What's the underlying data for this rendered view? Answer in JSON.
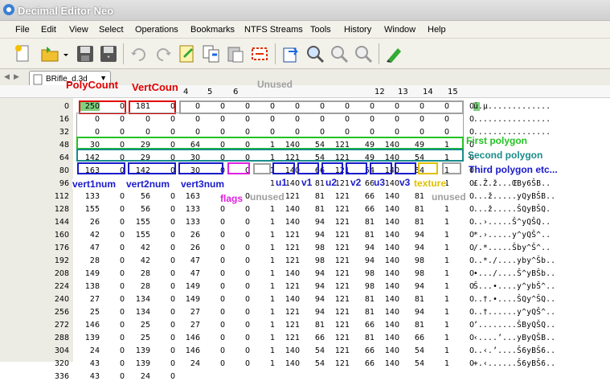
{
  "window": {
    "title": "Decimal Editor Neo"
  },
  "menu": [
    "File",
    "Edit",
    "View",
    "Select",
    "Operations",
    "Bookmarks",
    "NTFS Streams",
    "Tools",
    "History",
    "Window",
    "Help"
  ],
  "toolbar": {
    "icons": [
      "new-document-icon",
      "open-folder-icon",
      "dropdown-arrow-icon",
      "save-icon",
      "save-as-icon",
      "undo-icon",
      "redo-icon",
      "edit-notes-icon",
      "copy-icon",
      "paste-icon",
      "select-block-icon",
      "export-icon",
      "find-icon",
      "find-next-icon",
      "find-previous-icon",
      "go-to-icon"
    ]
  },
  "tab": {
    "label": "BRifle_d.3d"
  },
  "column_headers": [
    "4",
    "5",
    "6",
    "12",
    "13",
    "14",
    "15"
  ],
  "rows": [
    {
      "offset": "0",
      "values": [
        "250",
        "0",
        "181",
        "0",
        "0",
        "0",
        "0",
        "0",
        "0",
        "0",
        "0",
        "0",
        "0",
        "0",
        "0",
        "0"
      ],
      "ascii": "ú.µ............."
    },
    {
      "offset": "16",
      "values": [
        "0",
        "0",
        "0",
        "0",
        "0",
        "0",
        "0",
        "0",
        "0",
        "0",
        "0",
        "0",
        "0",
        "0",
        "0",
        "0"
      ],
      "ascii": "................"
    },
    {
      "offset": "32",
      "values": [
        "0",
        "0",
        "0",
        "0",
        "0",
        "0",
        "0",
        "0",
        "0",
        "0",
        "0",
        "0",
        "0",
        "0",
        "0",
        "0"
      ],
      "ascii": "................"
    },
    {
      "offset": "48",
      "values": [
        "30",
        "0",
        "29",
        "0",
        "64",
        "0",
        "0",
        "1",
        "140",
        "54",
        "121",
        "49",
        "140",
        "49",
        "1",
        "0"
      ],
      "ascii": ""
    },
    {
      "offset": "64",
      "values": [
        "142",
        "0",
        "29",
        "0",
        "30",
        "0",
        "0",
        "1",
        "121",
        "54",
        "121",
        "49",
        "140",
        "54",
        "1",
        "0"
      ],
      "ascii": ""
    },
    {
      "offset": "80",
      "values": [
        "163",
        "0",
        "142",
        "0",
        "30",
        "0",
        "0",
        "1",
        "140",
        "66",
        "121",
        "54",
        "140",
        "54",
        "1",
        "0"
      ],
      "ascii": ""
    },
    {
      "offset": "96",
      "values": [
        "",
        "",
        "",
        "",
        "",
        "",
        "",
        "1",
        "140",
        "81",
        "121",
        "66",
        "140",
        "66",
        "1",
        "0"
      ],
      "ascii": "£.Ž.ž...ŒBy6ŠB.."
    },
    {
      "offset": "112",
      "values": [
        "133",
        "0",
        "56",
        "0",
        "163",
        "0",
        "0",
        "1",
        "121",
        "81",
        "121",
        "66",
        "140",
        "81",
        "1",
        "0"
      ],
      "ascii": "...ž.....yQyBŠB.."
    },
    {
      "offset": "128",
      "values": [
        "155",
        "0",
        "56",
        "0",
        "133",
        "0",
        "0",
        "1",
        "140",
        "81",
        "121",
        "66",
        "140",
        "81",
        "1",
        "0"
      ],
      "ascii": "...ž.....ŠQyBŠQ."
    },
    {
      "offset": "144",
      "values": [
        "26",
        "0",
        "155",
        "0",
        "133",
        "0",
        "0",
        "1",
        "140",
        "94",
        "121",
        "81",
        "140",
        "81",
        "1",
        "0"
      ],
      "ascii": "..›.....Š^yQŠQ.."
    },
    {
      "offset": "160",
      "values": [
        "42",
        "0",
        "155",
        "0",
        "26",
        "0",
        "0",
        "1",
        "121",
        "94",
        "121",
        "81",
        "140",
        "94",
        "1",
        "0"
      ],
      "ascii": "*.›.....y^yQŠ^.."
    },
    {
      "offset": "176",
      "values": [
        "47",
        "0",
        "42",
        "0",
        "26",
        "0",
        "0",
        "1",
        "121",
        "98",
        "121",
        "94",
        "140",
        "94",
        "1",
        "0"
      ],
      "ascii": "/.*.....Šby^Š^.."
    },
    {
      "offset": "192",
      "values": [
        "28",
        "0",
        "42",
        "0",
        "47",
        "0",
        "0",
        "1",
        "121",
        "98",
        "121",
        "94",
        "140",
        "98",
        "1",
        "0"
      ],
      "ascii": "..*./....yby^Šb.."
    },
    {
      "offset": "208",
      "values": [
        "149",
        "0",
        "28",
        "0",
        "47",
        "0",
        "0",
        "1",
        "140",
        "94",
        "121",
        "98",
        "140",
        "98",
        "1",
        "0"
      ],
      "ascii": "•.../....Š^yBŠb.."
    },
    {
      "offset": "224",
      "values": [
        "138",
        "0",
        "28",
        "0",
        "149",
        "0",
        "0",
        "1",
        "121",
        "94",
        "121",
        "98",
        "140",
        "94",
        "1",
        "0"
      ],
      "ascii": "Š...•....y^ybŠ^.."
    },
    {
      "offset": "240",
      "values": [
        "27",
        "0",
        "134",
        "0",
        "149",
        "0",
        "0",
        "1",
        "140",
        "94",
        "121",
        "81",
        "140",
        "81",
        "1",
        "0"
      ],
      "ascii": "..†.•....ŠQy^ŠQ.."
    },
    {
      "offset": "256",
      "values": [
        "25",
        "0",
        "134",
        "0",
        "27",
        "0",
        "0",
        "1",
        "121",
        "94",
        "121",
        "81",
        "140",
        "94",
        "1",
        "0"
      ],
      "ascii": "..†......y^yQŠ^.."
    },
    {
      "offset": "272",
      "values": [
        "146",
        "0",
        "25",
        "0",
        "27",
        "0",
        "0",
        "1",
        "121",
        "81",
        "121",
        "66",
        "140",
        "81",
        "1",
        "0"
      ],
      "ascii": "’........ŠByQŠQ.."
    },
    {
      "offset": "288",
      "values": [
        "139",
        "0",
        "25",
        "0",
        "146",
        "0",
        "0",
        "1",
        "121",
        "66",
        "121",
        "81",
        "140",
        "66",
        "1",
        "0"
      ],
      "ascii": "‹....’...yByQŠB.."
    },
    {
      "offset": "304",
      "values": [
        "24",
        "0",
        "139",
        "0",
        "146",
        "0",
        "0",
        "1",
        "140",
        "54",
        "121",
        "66",
        "140",
        "54",
        "1",
        "0"
      ],
      "ascii": "..‹.’....Š6yBŠ6.."
    },
    {
      "offset": "320",
      "values": [
        "43",
        "0",
        "139",
        "0",
        "24",
        "0",
        "0",
        "1",
        "140",
        "54",
        "121",
        "66",
        "140",
        "54",
        "1",
        "0"
      ],
      "ascii": "+.‹......Š6yBŠ6.."
    },
    {
      "offset": "336",
      "values": [
        "43",
        "0",
        "24",
        "0",
        "",
        "",
        "",
        "",
        "",
        "",
        "",
        "",
        "",
        "",
        "",
        ""
      ],
      "ascii": ""
    }
  ],
  "annotations": {
    "polycount": "PolyCount",
    "vertcount": "VertCoun",
    "unused_top": "Unused",
    "first_polygon": "First polygon",
    "second_polygon": "Second polygon",
    "third_polygon": "Third polygon etc...",
    "vert1num": "vert1num",
    "vert2num": "vert2num",
    "vert3num": "vert3num",
    "flags": "flags",
    "unused": "unused",
    "u1": "u1",
    "v1": "v1",
    "u2": "u2",
    "v2": "v2",
    "u3": "u3",
    "v3": "v3",
    "texture": "texture",
    "unused_right": "unused"
  },
  "colors": {
    "red": "#e00000",
    "green": "#22c222",
    "teal": "#1a8c8c",
    "blue": "#1a1acc",
    "magenta": "#e020e0",
    "gray": "#a0a0a0",
    "yellow": "#e0c000"
  }
}
